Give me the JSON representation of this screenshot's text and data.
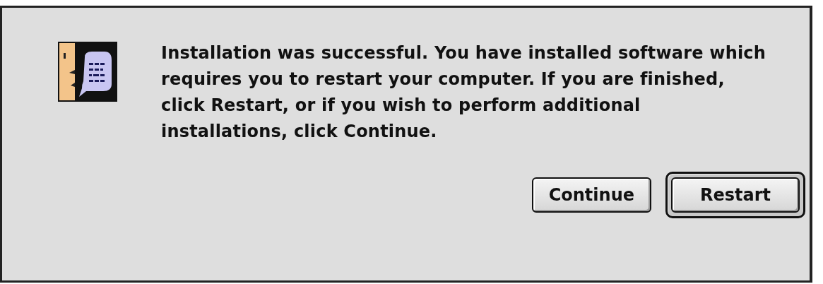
{
  "dialog": {
    "message": "Installation was successful. You have installed software which requires you to restart your computer. If you are finished, click Restart, or if you wish to perform additional installations, click Continue.",
    "buttons": [
      {
        "label": "Continue",
        "default": false
      },
      {
        "label": "Restart",
        "default": true
      }
    ]
  }
}
